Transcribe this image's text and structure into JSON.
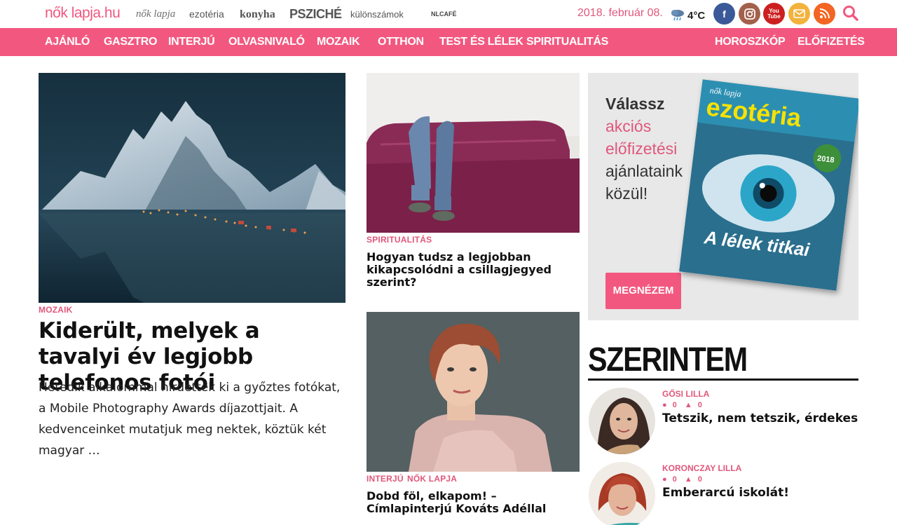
{
  "brands": {
    "main_logo": "nők lapja.hu",
    "items": [
      "nők lapja",
      "ezotéria",
      "konyha",
      "PSZICHÉ",
      "különszámok",
      "NLCAFÉ"
    ]
  },
  "header": {
    "date": "2018. február 08.",
    "temperature": "4°C"
  },
  "social": {
    "facebook": "f",
    "youtube": "You Tube"
  },
  "nav": {
    "items": [
      "AJÁNLÓ",
      "GASZTRO",
      "INTERJÚ",
      "OLVASNIVALÓ",
      "MOZAIK",
      "OTTHON",
      "TEST ÉS LÉLEK",
      "SPIRITUALITÁS"
    ],
    "right_items": [
      "HOROSZKÓP",
      "ELŐFIZETÉS"
    ]
  },
  "lead": {
    "category": "MOZAIK",
    "title": "Kiderült, melyek a tavalyi év legjobb telefonos fotói",
    "excerpt": "Hetedik alkalommal hirdették ki a győztes fotókat, a Mobile Photography Awards díjazottjait. A kedvenceinket mutatjuk meg nektek, köztük két magyar …"
  },
  "mid_articles": [
    {
      "category": "SPIRITUALITÁS",
      "title": "Hogyan tudsz a legjobban kikapcsolódni a csillagjegyed szerint?"
    },
    {
      "categories": [
        "INTERJÚ",
        "NŐK LAPJA"
      ],
      "title": "Dobd föl, elkapom! – Címlapinterjú Kováts Adéllal"
    }
  ],
  "ad": {
    "line1": "Válassz",
    "line2": "akciós előfizetési",
    "line3": "ajánlataink közül!",
    "button": "MEGNÉZEM",
    "magazine_brand": "nők lapja",
    "magazine_title": "ezotéria",
    "magazine_cover_text": "A lélek titkai",
    "magazine_year": "2018"
  },
  "szerintem": {
    "title": "SZERINTEM",
    "items": [
      {
        "author": "GŐSI LILLA",
        "comments": "0",
        "likes": "0",
        "title": "Tetszik, nem tetszik, érdekes"
      },
      {
        "author": "KORONCZAY LILLA",
        "comments": "0",
        "likes": "0",
        "title": "Emberarcú iskolát!"
      }
    ]
  },
  "colors": {
    "accent": "#f2587f",
    "text_accent": "#e0577b"
  }
}
